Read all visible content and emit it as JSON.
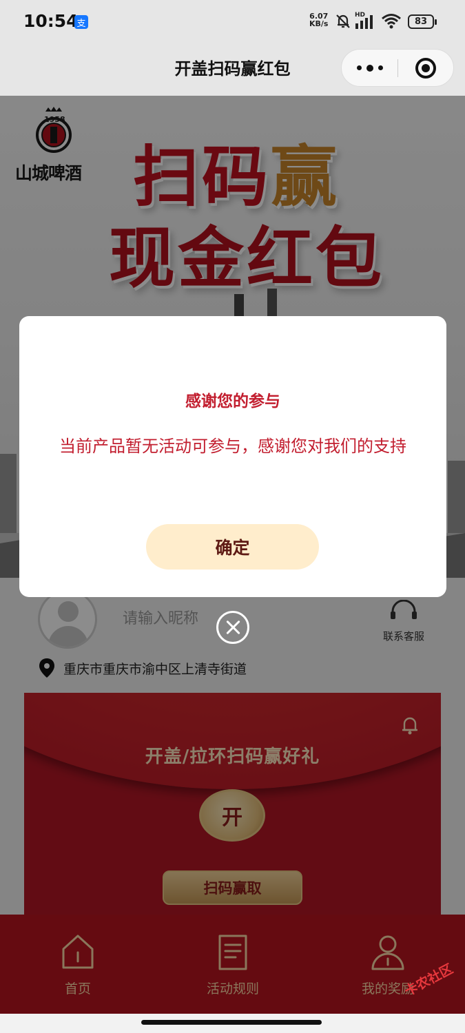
{
  "status_bar": {
    "time": "10:54",
    "app_badge": "支",
    "net_speed_value": "6.07",
    "net_speed_unit": "KB/s",
    "network_label": "HD",
    "battery": "83"
  },
  "header": {
    "title": "开盖扫码赢红包"
  },
  "banner": {
    "brand_year": "1958",
    "brand_name": "山城啤酒",
    "slogan_line1_red": "扫码",
    "slogan_line1_gold": "赢",
    "slogan_line2": "现金红包"
  },
  "profile": {
    "nickname_placeholder": "请输入昵称",
    "service_label": "联系客服",
    "location": "重庆市重庆市渝中区上清寺街道"
  },
  "red_card": {
    "title": "开盖/拉环扫码赢好礼",
    "open_label": "开",
    "scan_label": "扫码赢取"
  },
  "tabbar": {
    "items": [
      {
        "label": "首页",
        "icon": "home-icon"
      },
      {
        "label": "活动规则",
        "icon": "rules-document-icon"
      },
      {
        "label": "我的奖励",
        "icon": "user-icon"
      }
    ]
  },
  "modal": {
    "title": "感谢您的参与",
    "message": "当前产品暂无活动可参与，感谢您对我们的支持",
    "confirm_label": "确定"
  },
  "watermark": {
    "text": "卡农社区"
  },
  "colors": {
    "brand_red": "#b8141f",
    "modal_text_red": "#c21e2f",
    "confirm_bg": "#ffedcc",
    "gold_text": "#fbd9a8"
  }
}
